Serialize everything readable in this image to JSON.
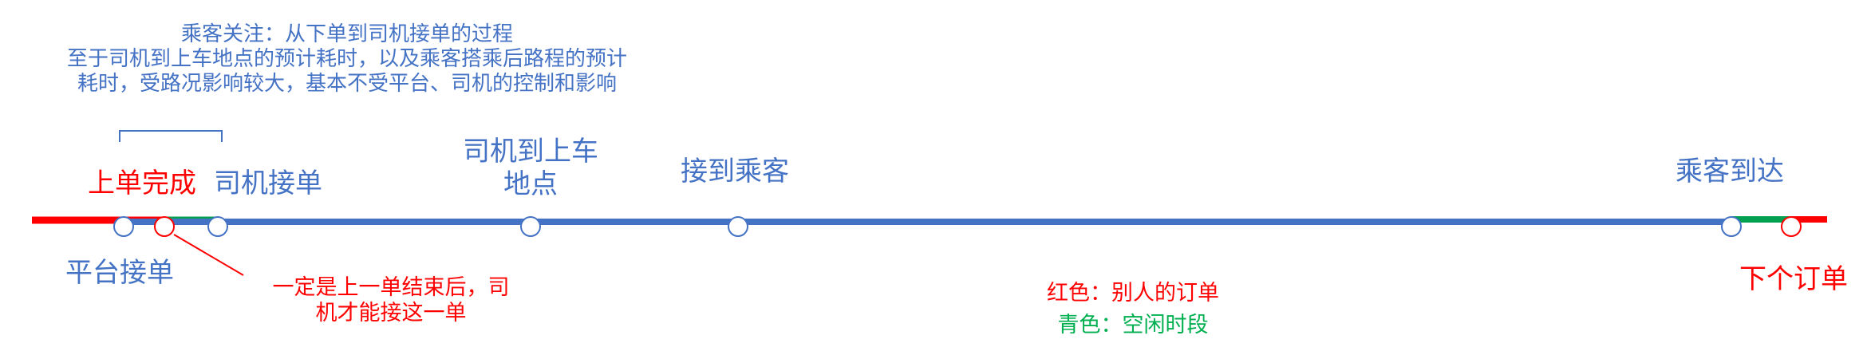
{
  "colors": {
    "blue": "#4472C4",
    "red": "#FF0000",
    "green": "#00A050"
  },
  "note": {
    "line1": "乘客关注：从下单到司机接单的过程",
    "line2": "至于司机到上车地点的预计耗时，以及乘客搭乘后路程的预计",
    "line3": "耗时，受路况影响较大，基本不受平台、司机的控制和影响"
  },
  "events": {
    "order_done": "上单完成",
    "driver_accept": "司机接单",
    "driver_arrive_line1": "司机到上车",
    "driver_arrive_line2": "地点",
    "pickup": "接到乘客",
    "arrive": "乘客到达",
    "platform_accept": "平台接单",
    "next_order": "下个订单"
  },
  "annotation": {
    "line1": "一定是上一单结束后，司",
    "line2": "机才能接这一单"
  },
  "legend": {
    "red": "红色：别人的订单",
    "green": "青色：空闲时段"
  }
}
